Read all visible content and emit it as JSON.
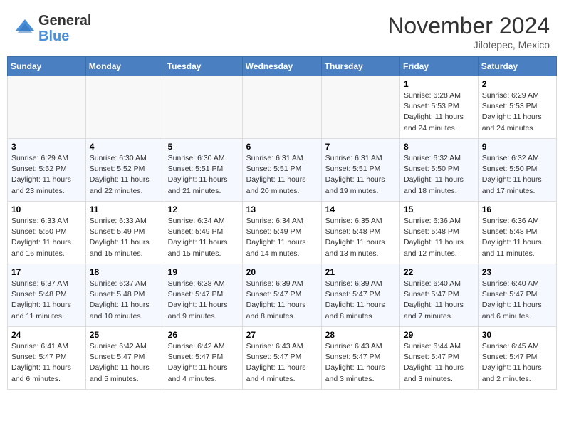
{
  "header": {
    "logo_general": "General",
    "logo_blue": "Blue",
    "month_title": "November 2024",
    "subtitle": "Jilotepec, Mexico"
  },
  "days_of_week": [
    "Sunday",
    "Monday",
    "Tuesday",
    "Wednesday",
    "Thursday",
    "Friday",
    "Saturday"
  ],
  "weeks": [
    [
      {
        "day": "",
        "info": ""
      },
      {
        "day": "",
        "info": ""
      },
      {
        "day": "",
        "info": ""
      },
      {
        "day": "",
        "info": ""
      },
      {
        "day": "",
        "info": ""
      },
      {
        "day": "1",
        "info": "Sunrise: 6:28 AM\nSunset: 5:53 PM\nDaylight: 11 hours and 24 minutes."
      },
      {
        "day": "2",
        "info": "Sunrise: 6:29 AM\nSunset: 5:53 PM\nDaylight: 11 hours and 24 minutes."
      }
    ],
    [
      {
        "day": "3",
        "info": "Sunrise: 6:29 AM\nSunset: 5:52 PM\nDaylight: 11 hours and 23 minutes."
      },
      {
        "day": "4",
        "info": "Sunrise: 6:30 AM\nSunset: 5:52 PM\nDaylight: 11 hours and 22 minutes."
      },
      {
        "day": "5",
        "info": "Sunrise: 6:30 AM\nSunset: 5:51 PM\nDaylight: 11 hours and 21 minutes."
      },
      {
        "day": "6",
        "info": "Sunrise: 6:31 AM\nSunset: 5:51 PM\nDaylight: 11 hours and 20 minutes."
      },
      {
        "day": "7",
        "info": "Sunrise: 6:31 AM\nSunset: 5:51 PM\nDaylight: 11 hours and 19 minutes."
      },
      {
        "day": "8",
        "info": "Sunrise: 6:32 AM\nSunset: 5:50 PM\nDaylight: 11 hours and 18 minutes."
      },
      {
        "day": "9",
        "info": "Sunrise: 6:32 AM\nSunset: 5:50 PM\nDaylight: 11 hours and 17 minutes."
      }
    ],
    [
      {
        "day": "10",
        "info": "Sunrise: 6:33 AM\nSunset: 5:50 PM\nDaylight: 11 hours and 16 minutes."
      },
      {
        "day": "11",
        "info": "Sunrise: 6:33 AM\nSunset: 5:49 PM\nDaylight: 11 hours and 15 minutes."
      },
      {
        "day": "12",
        "info": "Sunrise: 6:34 AM\nSunset: 5:49 PM\nDaylight: 11 hours and 15 minutes."
      },
      {
        "day": "13",
        "info": "Sunrise: 6:34 AM\nSunset: 5:49 PM\nDaylight: 11 hours and 14 minutes."
      },
      {
        "day": "14",
        "info": "Sunrise: 6:35 AM\nSunset: 5:48 PM\nDaylight: 11 hours and 13 minutes."
      },
      {
        "day": "15",
        "info": "Sunrise: 6:36 AM\nSunset: 5:48 PM\nDaylight: 11 hours and 12 minutes."
      },
      {
        "day": "16",
        "info": "Sunrise: 6:36 AM\nSunset: 5:48 PM\nDaylight: 11 hours and 11 minutes."
      }
    ],
    [
      {
        "day": "17",
        "info": "Sunrise: 6:37 AM\nSunset: 5:48 PM\nDaylight: 11 hours and 11 minutes."
      },
      {
        "day": "18",
        "info": "Sunrise: 6:37 AM\nSunset: 5:48 PM\nDaylight: 11 hours and 10 minutes."
      },
      {
        "day": "19",
        "info": "Sunrise: 6:38 AM\nSunset: 5:47 PM\nDaylight: 11 hours and 9 minutes."
      },
      {
        "day": "20",
        "info": "Sunrise: 6:39 AM\nSunset: 5:47 PM\nDaylight: 11 hours and 8 minutes."
      },
      {
        "day": "21",
        "info": "Sunrise: 6:39 AM\nSunset: 5:47 PM\nDaylight: 11 hours and 8 minutes."
      },
      {
        "day": "22",
        "info": "Sunrise: 6:40 AM\nSunset: 5:47 PM\nDaylight: 11 hours and 7 minutes."
      },
      {
        "day": "23",
        "info": "Sunrise: 6:40 AM\nSunset: 5:47 PM\nDaylight: 11 hours and 6 minutes."
      }
    ],
    [
      {
        "day": "24",
        "info": "Sunrise: 6:41 AM\nSunset: 5:47 PM\nDaylight: 11 hours and 6 minutes."
      },
      {
        "day": "25",
        "info": "Sunrise: 6:42 AM\nSunset: 5:47 PM\nDaylight: 11 hours and 5 minutes."
      },
      {
        "day": "26",
        "info": "Sunrise: 6:42 AM\nSunset: 5:47 PM\nDaylight: 11 hours and 4 minutes."
      },
      {
        "day": "27",
        "info": "Sunrise: 6:43 AM\nSunset: 5:47 PM\nDaylight: 11 hours and 4 minutes."
      },
      {
        "day": "28",
        "info": "Sunrise: 6:43 AM\nSunset: 5:47 PM\nDaylight: 11 hours and 3 minutes."
      },
      {
        "day": "29",
        "info": "Sunrise: 6:44 AM\nSunset: 5:47 PM\nDaylight: 11 hours and 3 minutes."
      },
      {
        "day": "30",
        "info": "Sunrise: 6:45 AM\nSunset: 5:47 PM\nDaylight: 11 hours and 2 minutes."
      }
    ]
  ]
}
